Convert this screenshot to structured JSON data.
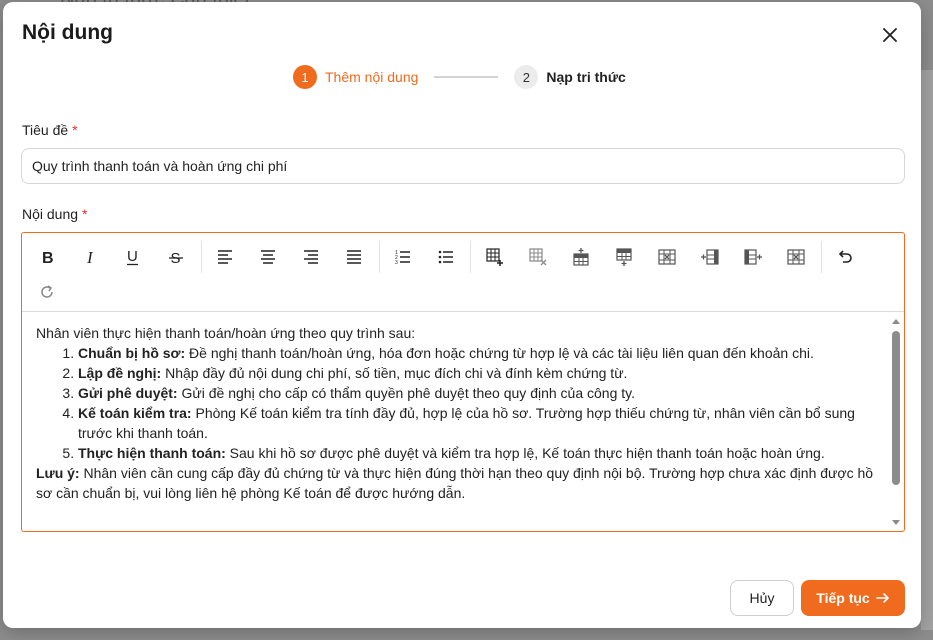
{
  "backdrop": {
    "partial_text": "Nạp tri thức Cần thiết"
  },
  "modal": {
    "title": "Nội dung",
    "close_icon": "close-icon"
  },
  "stepper": {
    "steps": [
      {
        "number": "1",
        "label": "Thêm nội dung",
        "state": "active"
      },
      {
        "number": "2",
        "label": "Nạp tri thức",
        "state": "inactive"
      }
    ]
  },
  "form": {
    "title_label": "Tiêu đề",
    "title_required": "*",
    "title_value": "Quy trình thanh toán và hoàn ứng chi phí",
    "content_label": "Nội dung",
    "content_required": "*"
  },
  "toolbar": {
    "buttons": [
      "bold-icon",
      "italic-icon",
      "underline-icon",
      "strikethrough-icon",
      "align-left-icon",
      "align-center-icon",
      "align-right-icon",
      "align-justify-icon",
      "ordered-list-icon",
      "bullet-list-icon",
      "insert-table-icon",
      "delete-table-icon",
      "insert-row-above-icon",
      "insert-row-below-icon",
      "delete-row-icon",
      "insert-column-left-icon",
      "insert-column-right-icon",
      "delete-column-icon",
      "undo-icon",
      "redo-icon"
    ]
  },
  "editor_content": {
    "intro": "Nhân viên thực hiện thanh toán/hoàn ứng theo quy trình sau:",
    "items": [
      {
        "bold": "Chuẩn bị hồ sơ:",
        "text": " Đề nghị thanh toán/hoàn ứng, hóa đơn hoặc chứng từ hợp lệ và các tài liệu liên quan đến khoản chi."
      },
      {
        "bold": "Lập đề nghị:",
        "text": " Nhập đầy đủ nội dung chi phí, số tiền, mục đích chi và đính kèm chứng từ."
      },
      {
        "bold": "Gửi phê duyệt:",
        "text": " Gửi đề nghị cho cấp có thẩm quyền phê duyệt theo quy định của công ty."
      },
      {
        "bold": "Kế toán kiểm tra:",
        "text": " Phòng Kế toán kiểm tra tính đầy đủ, hợp lệ của hồ sơ. Trường hợp thiếu chứng từ, nhân viên cần bổ sung trước khi thanh toán."
      },
      {
        "bold": "Thực hiện thanh toán:",
        "text": " Sau khi hồ sơ được phê duyệt và kiểm tra hợp lệ, Kế toán thực hiện thanh toán hoặc hoàn ứng."
      }
    ],
    "note_bold": "Lưu ý:",
    "note_text": " Nhân viên cần cung cấp đầy đủ chứng từ và thực hiện đúng thời hạn theo quy định nội bộ. Trường hợp chưa xác định được hồ sơ cần chuẩn bị, vui lòng liên hệ phòng Kế toán để được hướng dẫn."
  },
  "footer": {
    "cancel_label": "Hủy",
    "continue_label": "Tiếp tục",
    "continue_icon": "arrow-right-icon"
  },
  "colors": {
    "accent": "#f06b1d",
    "required": "#e0322b"
  }
}
